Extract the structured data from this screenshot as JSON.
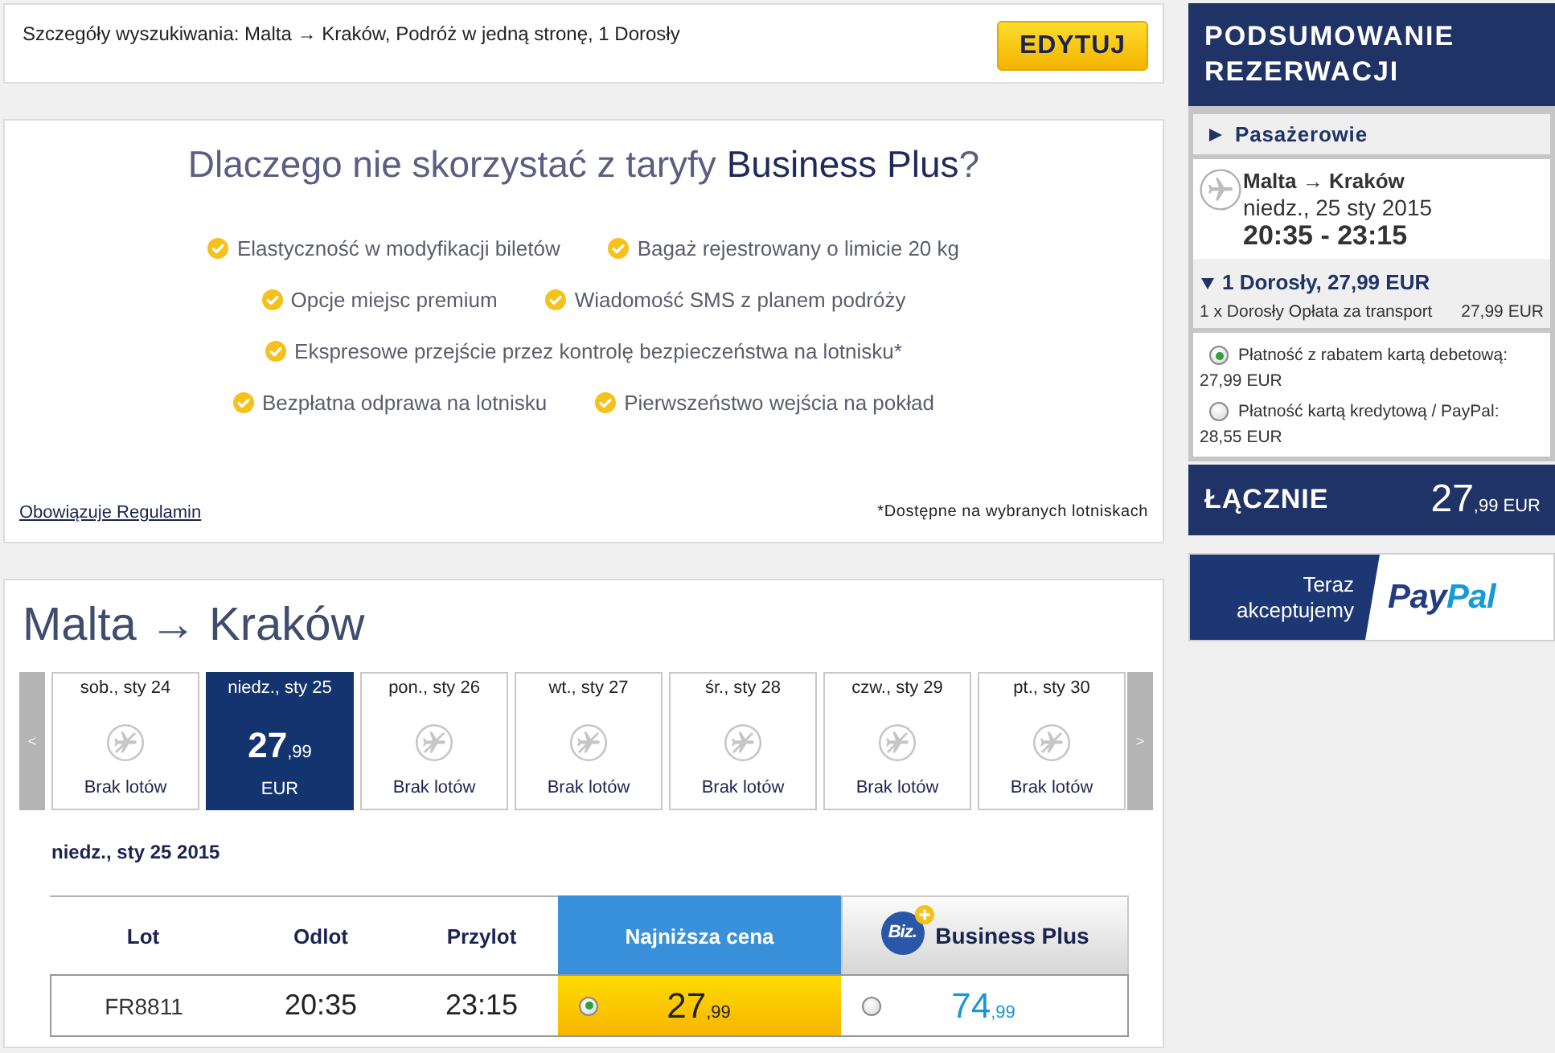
{
  "search_bar": {
    "summary": "Szczegóły wyszukiwania: Malta → Kraków, Podróż w jedną stronę, 1 Dorosły",
    "edit_button": "EDYTUJ"
  },
  "promo": {
    "title": "Dlaczego nie skorzystać z taryfy **Business Plus**?",
    "feature_rows": [
      {
        "items": [
          "Elastyczność w modyfikacji biletów",
          "Bagaż rejestrowany o limicie 20 kg"
        ]
      },
      {
        "items": [
          "Opcje miejsc premium",
          "Wiadomość SMS z planem podróży"
        ]
      },
      {
        "items": [
          "Ekspresowe przejście przez kontrolę bezpieczeństwa na lotnisku*"
        ]
      },
      {
        "items": [
          "Bezpłatna odprawa na lotnisku",
          "Pierwszeństwo wejścia na pokład"
        ]
      }
    ],
    "terms_link": "Obowiązuje Regulamin",
    "footnote": "*Dostępne na wybranych lotniskach"
  },
  "flights": {
    "title": "Malta → Kraków",
    "prev_arrow": "<",
    "next_arrow": ">",
    "days": [
      {
        "label": "sob., sty 24",
        "kind": "no_flights",
        "status": "Brak lotów",
        "selected": false
      },
      {
        "label": "niedz., sty 25",
        "kind": "price",
        "price": {
          "whole": "27",
          "fraction": ",99"
        },
        "currency": "EUR",
        "selected": true
      },
      {
        "label": "pon., sty 26",
        "kind": "no_flights",
        "status": "Brak lotów",
        "selected": false
      },
      {
        "label": "wt., sty 27",
        "kind": "no_flights",
        "status": "Brak lotów",
        "selected": false
      },
      {
        "label": "śr., sty 28",
        "kind": "no_flights",
        "status": "Brak lotów",
        "selected": false
      },
      {
        "label": "czw., sty 29",
        "kind": "no_flights",
        "status": "Brak lotów",
        "selected": false
      },
      {
        "label": "pt., sty 30",
        "kind": "no_flights",
        "status": "Brak lotów",
        "selected": false
      }
    ],
    "date_heading": "niedz., sty 25 2015",
    "table": {
      "columns": [
        "Lot",
        "Odlot",
        "Przylot"
      ],
      "fares": [
        {
          "label": "Najniższa cena",
          "kind": "standard",
          "selected": true
        },
        {
          "label": "Business Plus",
          "kind": "business",
          "badge": "Biz.",
          "selected": false
        }
      ],
      "rows": [
        {
          "flight": "FR8811",
          "departure": "20:35",
          "arrival": "23:15",
          "prices": [
            {
              "whole": "27",
              "fraction": ",99",
              "selected": true
            },
            {
              "whole": "74",
              "fraction": ",99",
              "selected": false
            }
          ]
        }
      ]
    }
  },
  "summary": {
    "title": "PODSUMOWANIE REZERWACJI",
    "passengers": {
      "label": "Pasażerowie",
      "expanded": false
    },
    "flight": {
      "route": "Malta → Kraków",
      "date": "niedz., 25 sty 2015",
      "times": "20:35 - 23:15"
    },
    "fare_group": {
      "label": "1 Dorosły, 27,99 EUR",
      "expanded": true,
      "lines": [
        {
          "description": "1 x Dorosły Opłata za transport",
          "amount": "27,99 EUR"
        }
      ]
    },
    "payment_options": [
      {
        "label": "Płatność z rabatem kartą debetową:",
        "amount": "27,99 EUR",
        "selected": true
      },
      {
        "label": "Płatność kartą kredytową / PayPal:",
        "amount": "28,55 EUR",
        "selected": false
      }
    ],
    "total": {
      "label": "ŁĄCZNIE",
      "whole": "27",
      "fraction": ",99",
      "currency": "EUR"
    }
  },
  "paypal_banner": {
    "text": "Teraz akceptujemy",
    "logo": [
      "Pay",
      "Pal"
    ]
  }
}
